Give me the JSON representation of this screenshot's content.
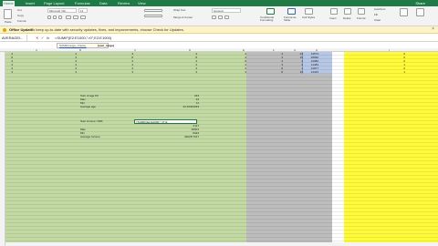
{
  "ribbon": {
    "tabs": [
      "Home",
      "Insert",
      "Page Layout",
      "Formulas",
      "Data",
      "Review",
      "View"
    ],
    "account_label": "Share",
    "paste_label": "Paste",
    "cut_label": "Cut",
    "copy_label": "Copy",
    "format_label": "Format",
    "font_name": "Microsoft Yah...",
    "font_size": "12",
    "wrap_text_label": "Wrap Text",
    "merge_label": "Merge & Center",
    "number_format": "General",
    "conditional_formatting_label": "Conditional Formatting",
    "format_as_table_label": "Format as Table",
    "cell_styles_label": "Cell Styles",
    "insert_label": "Insert",
    "delete_label": "Delete",
    "format_cells_label": "Format",
    "autosum_label": "AutoSum",
    "fill_label": "Fill",
    "clear_label": "Clear"
  },
  "message_bar": {
    "title": "Office Update",
    "text": "To keep up-to-date with security updates, fixes, and improvements, choose Check for Updates."
  },
  "formula_bar": {
    "name_box": "AVERAGEI...",
    "cancel": "✕",
    "confirm": "✓",
    "fx": "fx",
    "formula": "=SUMIF(E2:E1000,\">0\",E2:E1000)"
  },
  "tooltip": {
    "function_label": "SUMIF(range, criteria,",
    "current_arg": "[sum_range]"
  },
  "columns": [
    "A",
    "B",
    "C",
    "D",
    "E",
    "F",
    "G",
    "H",
    "I"
  ],
  "rows_top": [
    [
      "4",
      "4",
      "3",
      "3",
      "4",
      "3",
      "23",
      "13573",
      "0"
    ],
    [
      "8",
      "3",
      "8",
      "8",
      "4",
      "3",
      "15",
      "28990",
      "0"
    ],
    [
      "4",
      "3",
      "3",
      "3",
      "8",
      "3",
      "4",
      "10980",
      "0"
    ],
    [
      "4",
      "3",
      "4",
      "3",
      "4",
      "3",
      "2",
      "11483",
      "1"
    ],
    [
      "3",
      "3",
      "3",
      "3",
      "4",
      "8",
      "1",
      "12877",
      "0"
    ],
    [
      "4",
      "4",
      "3",
      "3",
      "4",
      "8",
      "34",
      "14443",
      "1"
    ]
  ],
  "summary1": [
    {
      "label": "Sum of age 60",
      "value": "233"
    },
    {
      "label": "Max",
      "value": "34"
    },
    {
      "label": "Min",
      "value": "11"
    },
    {
      "label": "Average age",
      "value": "23.33333333"
    }
  ],
  "summary2_first_label": "Sum income >50K",
  "active_cell_formula": "=SUMIF(E2:E1000,\">0\",E",
  "summary2_rest": [
    {
      "label": "Max",
      "value": "48301"
    },
    {
      "label": "Min",
      "value": "8424"
    },
    {
      "label": "Average Income",
      "value": "34028.7317"
    }
  ],
  "summary2_first_value": "2117",
  "colors": {
    "green_band": "#c2d9a4",
    "gray_band": "#bdbdbd",
    "yellow_band": "#fffb3a",
    "highlight": "#b6c7e6",
    "ribbon": "#1f7a45"
  }
}
